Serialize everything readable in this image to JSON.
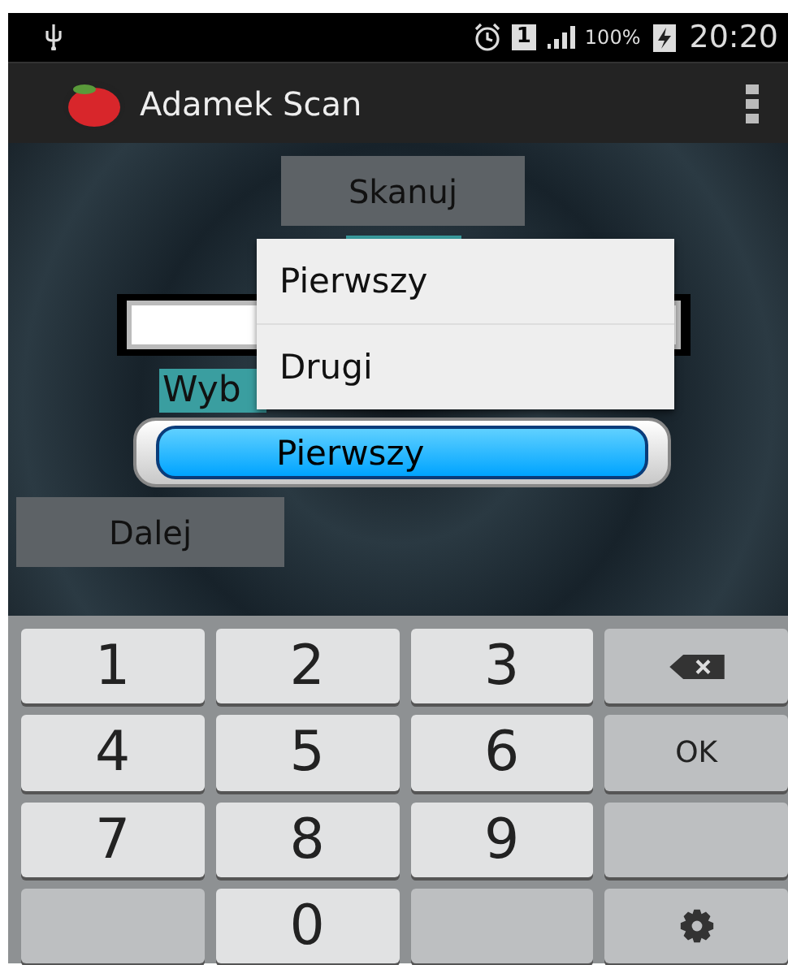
{
  "status_bar": {
    "sim": "1",
    "battery": "100%",
    "time": "20:20"
  },
  "app_bar": {
    "title": "Adamek Scan"
  },
  "form": {
    "scan_button": "Skanuj",
    "label": "Wyb",
    "spinner": {
      "value": "Pierwszy"
    },
    "next_button": "Dalej"
  },
  "dropdown_menu": {
    "items": [
      {
        "label": "Pierwszy"
      },
      {
        "label": "Drugi"
      }
    ]
  },
  "keyboard": {
    "keys": [
      {
        "kind": "digit",
        "label": "1"
      },
      {
        "kind": "digit",
        "label": "2"
      },
      {
        "kind": "digit",
        "label": "3"
      },
      {
        "kind": "backspace"
      },
      {
        "kind": "digit",
        "label": "4"
      },
      {
        "kind": "digit",
        "label": "5"
      },
      {
        "kind": "digit",
        "label": "6"
      },
      {
        "kind": "function",
        "label": "OK"
      },
      {
        "kind": "digit",
        "label": "7"
      },
      {
        "kind": "digit",
        "label": "8"
      },
      {
        "kind": "digit",
        "label": "9"
      },
      {
        "kind": "blank"
      },
      {
        "kind": "blank"
      },
      {
        "kind": "digit",
        "label": "0"
      },
      {
        "kind": "blank"
      },
      {
        "kind": "settings"
      }
    ]
  }
}
